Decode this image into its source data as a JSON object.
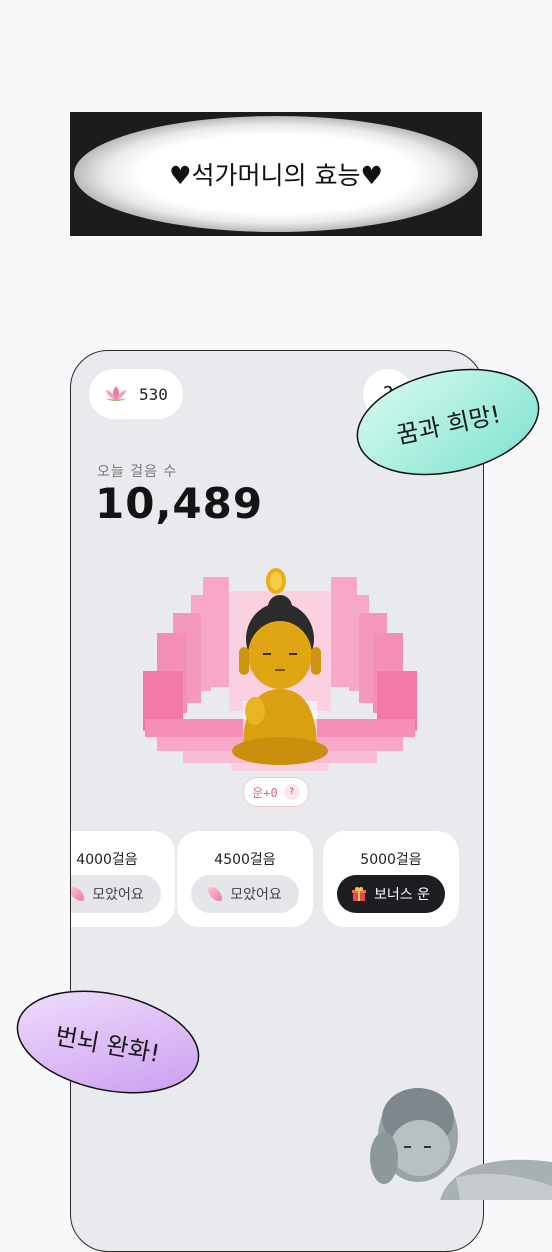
{
  "banner": {
    "title": "♥석가머니의 효능♥"
  },
  "app": {
    "coin_count": "530",
    "help_icon": "?",
    "steps_label": "오늘 걸음 수",
    "steps_value": "10,489",
    "luck_label": "운+0",
    "luck_help": "?",
    "milestones": [
      {
        "steps": "4000걸음",
        "button": "모았어요",
        "state": "collected",
        "icon": "petal-icon"
      },
      {
        "steps": "4500걸음",
        "button": "모았어요",
        "state": "collected",
        "icon": "petal-icon"
      },
      {
        "steps": "5000걸음",
        "button": "보너스 운",
        "state": "bonus",
        "icon": "gift-icon"
      }
    ]
  },
  "bubbles": {
    "top_right": "꿈과 희망!",
    "bottom_left": "번뇌 완화!"
  },
  "colors": {
    "lotus_pink": "#f48fb6",
    "buddha_gold": "#d9a011",
    "bubble_mint": "#a9efe0",
    "bubble_lilac": "#dcb6f5"
  }
}
